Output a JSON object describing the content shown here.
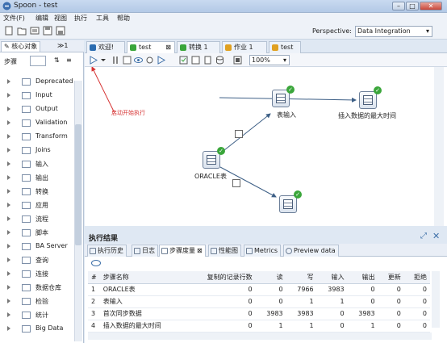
{
  "window": {
    "title": "Spoon - test"
  },
  "menu": [
    "文件(F)",
    "编辑",
    "视图",
    "执行",
    "工具",
    "帮助"
  ],
  "perspective": {
    "label": "Perspective:",
    "value": "Data Integration"
  },
  "left_tabs": [
    "核心对象",
    "≫1"
  ],
  "steps_label": "步骤",
  "tree": [
    "Deprecated",
    "Input",
    "Output",
    "Validation",
    "Transform",
    "Joins",
    "输入",
    "输出",
    "转换",
    "应用",
    "流程",
    "脚本",
    "BA Server",
    "查询",
    "连接",
    "数据仓库",
    "检验",
    "统计",
    "Big Data"
  ],
  "editor_tabs": [
    {
      "label": "欢迎!",
      "color": "#2b6cb0"
    },
    {
      "label": "test",
      "color": "#3aa63a"
    },
    {
      "label": "转换 1",
      "color": "#3aa63a"
    },
    {
      "label": "作业 1",
      "color": "#e0a020"
    },
    {
      "label": "test",
      "color": "#e0a020"
    }
  ],
  "zoom": "100%",
  "canvas": {
    "steps": [
      "表输入",
      "插入数据的最大时间",
      "ORACLE表",
      ""
    ],
    "annotation": "启动开始执行"
  },
  "results": {
    "title": "执行结果",
    "tabs": [
      "执行历史",
      "日志",
      "步骤度量",
      "性能图",
      "Metrics",
      "Preview data"
    ],
    "columns": [
      "#",
      "步骤名称",
      "复制的记录行数",
      "读",
      "写",
      "输入",
      "输出",
      "更新",
      "拒绝"
    ],
    "rows": [
      [
        "1",
        "ORACLE表",
        "0",
        "0",
        "7966",
        "3983",
        "0",
        "0",
        "0"
      ],
      [
        "2",
        "表输入",
        "0",
        "0",
        "1",
        "1",
        "0",
        "0",
        "0"
      ],
      [
        "3",
        "首次同步数据",
        "0",
        "3983",
        "3983",
        "0",
        "3983",
        "0",
        "0"
      ],
      [
        "4",
        "插入数据的最大时间",
        "0",
        "1",
        "1",
        "0",
        "1",
        "0",
        "0"
      ]
    ]
  }
}
